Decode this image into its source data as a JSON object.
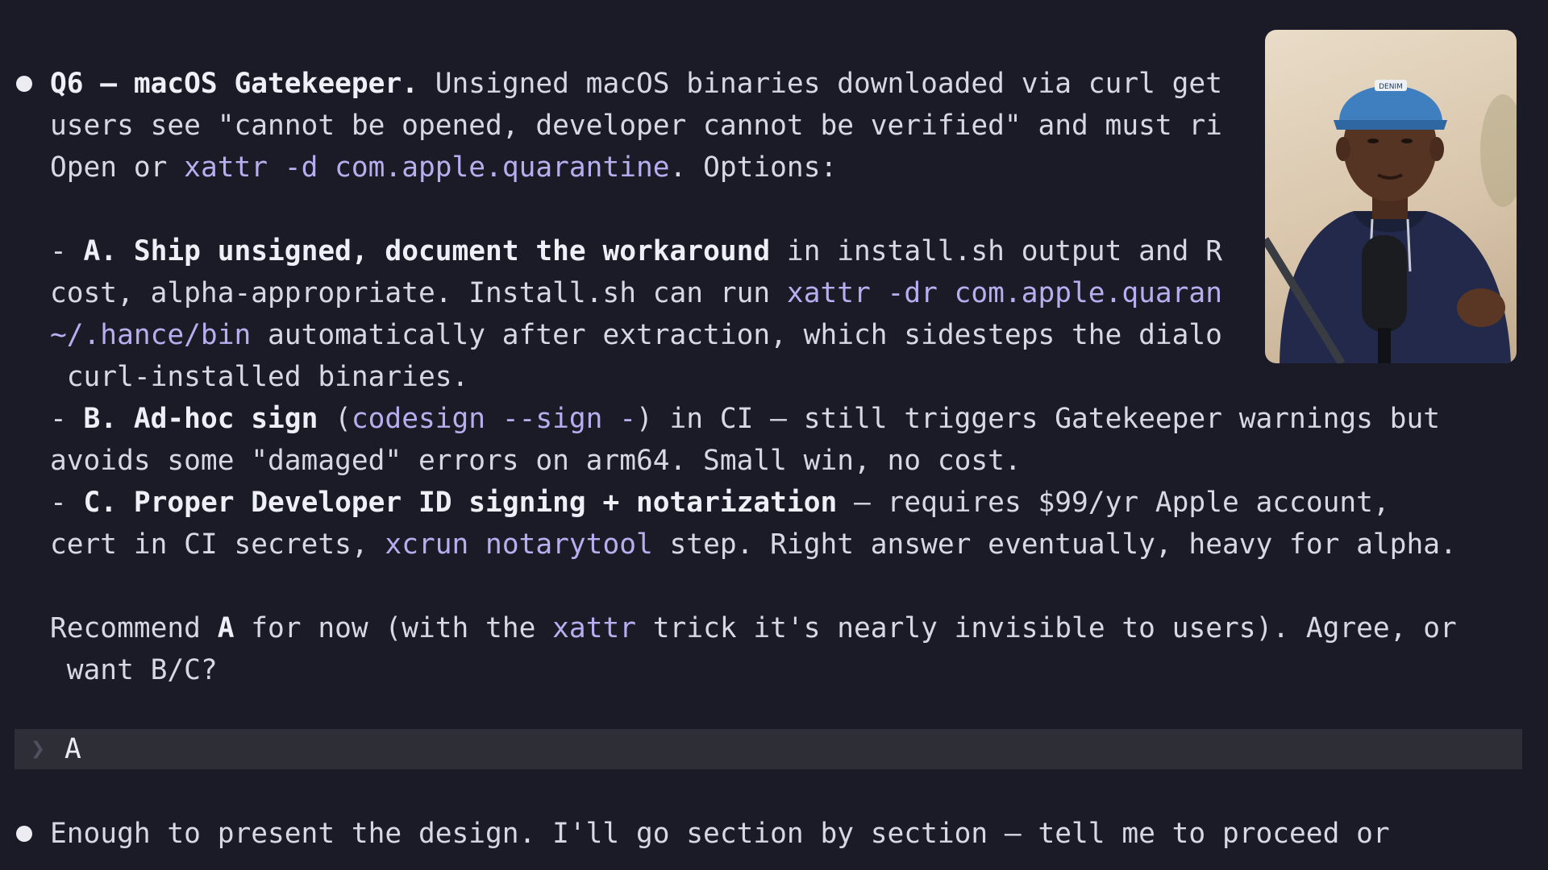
{
  "q6": {
    "l1a": "Q6 — macOS Gatekeeper.",
    "l1b": " Unsigned macOS binaries downloaded via curl get",
    "l2": "users see \"cannot be opened, developer cannot be verified\" and must ri",
    "l3a": "Open or ",
    "l3b": "xattr -d com.apple.quarantine",
    "l3c": ". Options:"
  },
  "opt_a": {
    "l1a": "- ",
    "l1b": "A. Ship unsigned, document the workaround",
    "l1c": " in install.sh output and R",
    "l2a": "cost, alpha-appropriate. Install.sh can run ",
    "l2b": "xattr -dr com.apple.quaran",
    "l3a": "~/.hance/bin",
    "l3b": " automatically after extraction, which sidesteps the dialo",
    "l4": " curl-installed binaries."
  },
  "opt_b": {
    "l1a": "- ",
    "l1b": "B. Ad-hoc sign",
    "l1c": " (",
    "l1d": "codesign --sign -",
    "l1e": ") in CI — still triggers Gatekeeper warnings but",
    "l2": "avoids some \"damaged\" errors on arm64. Small win, no cost."
  },
  "opt_c": {
    "l1a": "- ",
    "l1b": "C. Proper Developer ID signing + notarization",
    "l1c": " — requires $99/yr Apple account,",
    "l2a": "cert in CI secrets, ",
    "l2b": "xcrun notarytool",
    "l2c": " step. Right answer eventually, heavy for alpha."
  },
  "recommend": {
    "l1a": "Recommend ",
    "l1b": "A",
    "l1c": " for now (with the ",
    "l1d": "xattr",
    "l1e": " trick it's nearly invisible to users). Agree, or",
    "l2": " want B/C?"
  },
  "prompt": {
    "chevron": "❯",
    "input": "A"
  },
  "final": {
    "text": "Enough to present the design. I'll go section by section — tell me to proceed or"
  },
  "webcam": {
    "cap_text": "DENIM"
  },
  "colors": {
    "background": "#1a1b26",
    "text": "#d6d8e4",
    "bold": "#eef0f8",
    "code": "#b7aef0",
    "prompt_bar": "#2d2e36"
  }
}
